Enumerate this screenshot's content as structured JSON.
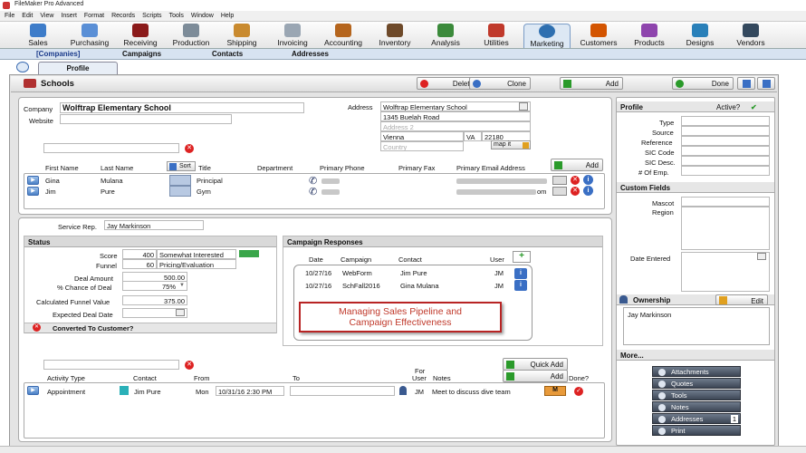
{
  "window": {
    "title": "FileMaker Pro Advanced"
  },
  "menu": [
    "File",
    "Edit",
    "View",
    "Insert",
    "Format",
    "Records",
    "Scripts",
    "Tools",
    "Window",
    "Help"
  ],
  "modules": [
    {
      "label": "Sales",
      "color": "#3d7cc9"
    },
    {
      "label": "Purchasing",
      "color": "#5a8fd6"
    },
    {
      "label": "Receiving",
      "color": "#8b1a1a"
    },
    {
      "label": "Production",
      "color": "#7d8c99"
    },
    {
      "label": "Shipping",
      "color": "#c98a2e"
    },
    {
      "label": "Invoicing",
      "color": "#9aa6b3"
    },
    {
      "label": "Accounting",
      "color": "#b5651d"
    },
    {
      "label": "Inventory",
      "color": "#6e4a2a"
    },
    {
      "label": "Analysis",
      "color": "#3b8a3b"
    },
    {
      "label": "Utilities",
      "color": "#c0392b"
    },
    {
      "label": "Marketing",
      "color": "#2e6fb0"
    },
    {
      "label": "Customers",
      "color": "#d35400"
    },
    {
      "label": "Products",
      "color": "#8e44ad"
    },
    {
      "label": "Designs",
      "color": "#2980b9"
    },
    {
      "label": "Vendors",
      "color": "#34495e"
    }
  ],
  "subnav": {
    "companies": "[Companies]",
    "campaigns": "Campaigns",
    "contacts": "Contacts",
    "addresses": "Addresses"
  },
  "tab": "Profile",
  "toolbar": {
    "title": "Schools",
    "delete": "Delete",
    "clone": "Clone",
    "add": "Add",
    "done": "Done"
  },
  "company": {
    "label_company": "Company",
    "name": "Wolftrap Elementary School",
    "label_website": "Website",
    "website": "",
    "label_address": "Address",
    "addr1": "Wolftrap Elementary School",
    "addr2": "1345 Buelah Road",
    "addr3_placeholder": "Address 2",
    "city": "Vienna",
    "state": "VA",
    "zip": "22180",
    "country_placeholder": "Country",
    "mapit": "map it"
  },
  "contacts": {
    "headers": {
      "first": "First Name",
      "last": "Last Name",
      "sort": "Sort",
      "title": "Title",
      "dept": "Department",
      "phone": "Primary Phone",
      "fax": "Primary Fax",
      "email": "Primary Email Address"
    },
    "add": "Add",
    "rows": [
      {
        "first": "Gina",
        "last": "Mulana",
        "title": "Principal",
        "email_suffix": ""
      },
      {
        "first": "Jim",
        "last": "Pure",
        "title": "Gym",
        "email_suffix": "om"
      }
    ]
  },
  "service": {
    "label": "Service Rep.",
    "value": "Jay Markinson"
  },
  "status": {
    "title": "Status",
    "score_label": "Score",
    "score": "400",
    "score_text": "Somewhat Interested",
    "funnel_label": "Funnel",
    "funnel": "60",
    "funnel_text": "Pricing/Evaluation",
    "deal_label": "Deal Amount",
    "deal": "500.00",
    "chance_label": "% Chance of Deal",
    "chance": "75%",
    "calc_label": "Calculated Funnel Value",
    "calc": "375.00",
    "close_label": "Expected Deal Date",
    "close": "",
    "converted": "Converted To Customer?"
  },
  "campaigns": {
    "title": "Campaign Responses",
    "headers": {
      "date": "Date",
      "campaign": "Campaign",
      "contact": "Contact",
      "user": "User"
    },
    "rows": [
      {
        "date": "10/27/16",
        "campaign": "WebForm",
        "contact": "Jim Pure",
        "user": "JM"
      },
      {
        "date": "10/27/16",
        "campaign": "SchFall2016",
        "contact": "Gina Mulana",
        "user": "JM"
      }
    ]
  },
  "callout": {
    "line1": "Managing Sales Pipeline and",
    "line2": "Campaign Effectiveness"
  },
  "activities": {
    "quick_add": "Quick Add",
    "add": "Add",
    "headers": {
      "type": "Activity Type",
      "contact": "Contact",
      "from": "From",
      "to": "To",
      "for_user_1": "For",
      "for_user_2": "User",
      "notes": "Notes",
      "done": "Done?"
    },
    "row": {
      "type": "Appointment",
      "contact": "Jim Pure",
      "day": "Mon",
      "from": "10/31/16  2:30 PM",
      "to": "",
      "user": "JM",
      "notes": "Meet to discuss dive team",
      "m": "M"
    }
  },
  "profile": {
    "title": "Profile",
    "active_label": "Active?",
    "fields": [
      "Type",
      "Source",
      "Reference",
      "SIC Code",
      "SIC Desc.",
      "# Of Emp."
    ]
  },
  "custom": {
    "title": "Custom Fields",
    "fields": [
      "Mascot",
      "Region"
    ],
    "date_entered": "Date Entered"
  },
  "ownership": {
    "title": "Ownership",
    "edit": "Edit",
    "owner": "Jay Markinson"
  },
  "more": {
    "title": "More...",
    "items": [
      "Attachments",
      "Quotes",
      "Tools",
      "Notes",
      "Addresses",
      "Print"
    ],
    "addresses_count": "1"
  }
}
